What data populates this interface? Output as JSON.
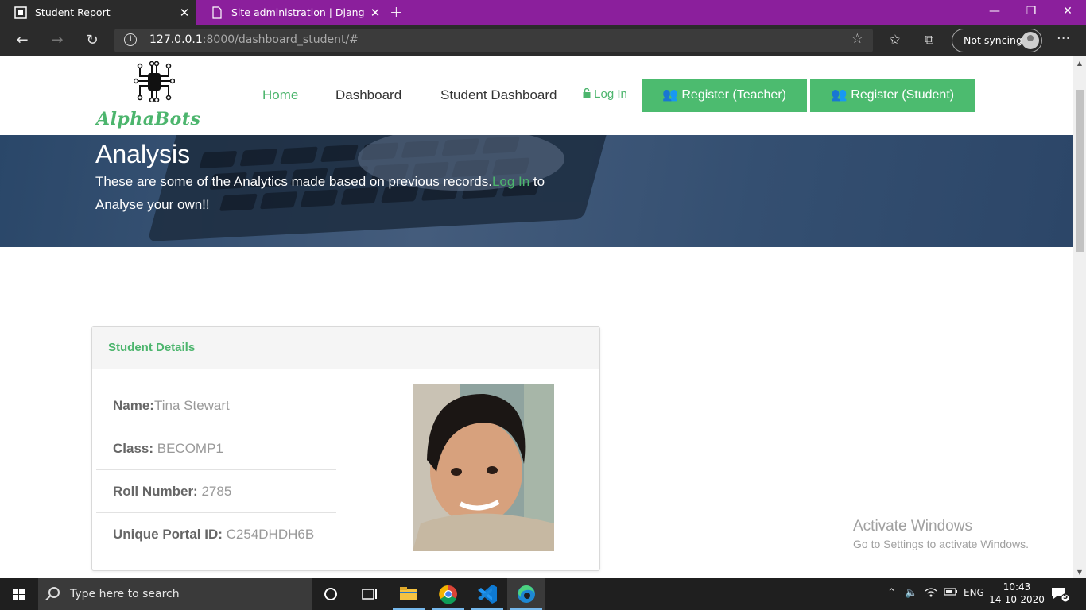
{
  "browser": {
    "tabs": [
      {
        "title": "Student Report",
        "active": true
      },
      {
        "title": "Site administration | Django site",
        "active": false
      }
    ],
    "new_tab": "+",
    "window_controls": {
      "minimize": "—",
      "restore": "❐",
      "close": "✕"
    },
    "url_host": "127.0.0.1",
    "url_rest": ":8000/dashboard_student/#",
    "sync_label": "Not syncing",
    "more": "···"
  },
  "site": {
    "logo_text": "AlphaBots",
    "nav": {
      "home": "Home",
      "dashboard": "Dashboard",
      "student_dashboard": "Student Dashboard",
      "login": "Log In",
      "register_teacher": "Register (Teacher)",
      "register_student": "Register (Student)"
    },
    "hero": {
      "title": "Analysis",
      "text_before": "These are some of the Analytics made based on previous records.",
      "text_link": "Log In",
      "text_after": " to Analyse your own!!"
    },
    "student_card": {
      "heading": "Student Details",
      "name_label": "Name:",
      "name_value": "Tina Stewart",
      "class_label": "Class:",
      "class_value": " BECOMP1",
      "roll_label": "Roll Number:",
      "roll_value": " 2785",
      "portal_label": "Unique Portal ID:",
      "portal_value": " C254DHDH6B"
    },
    "watermark": {
      "line1": "Activate Windows",
      "line2": "Go to Settings to activate Windows."
    }
  },
  "taskbar": {
    "search_placeholder": "Type here to search",
    "language": "ENG",
    "time": "10:43",
    "date": "14-10-2020",
    "notification_count": "5"
  },
  "colors": {
    "accent": "#4cb56d",
    "browser_tabbar": "#8b1f9c",
    "hero": "#344f71"
  }
}
